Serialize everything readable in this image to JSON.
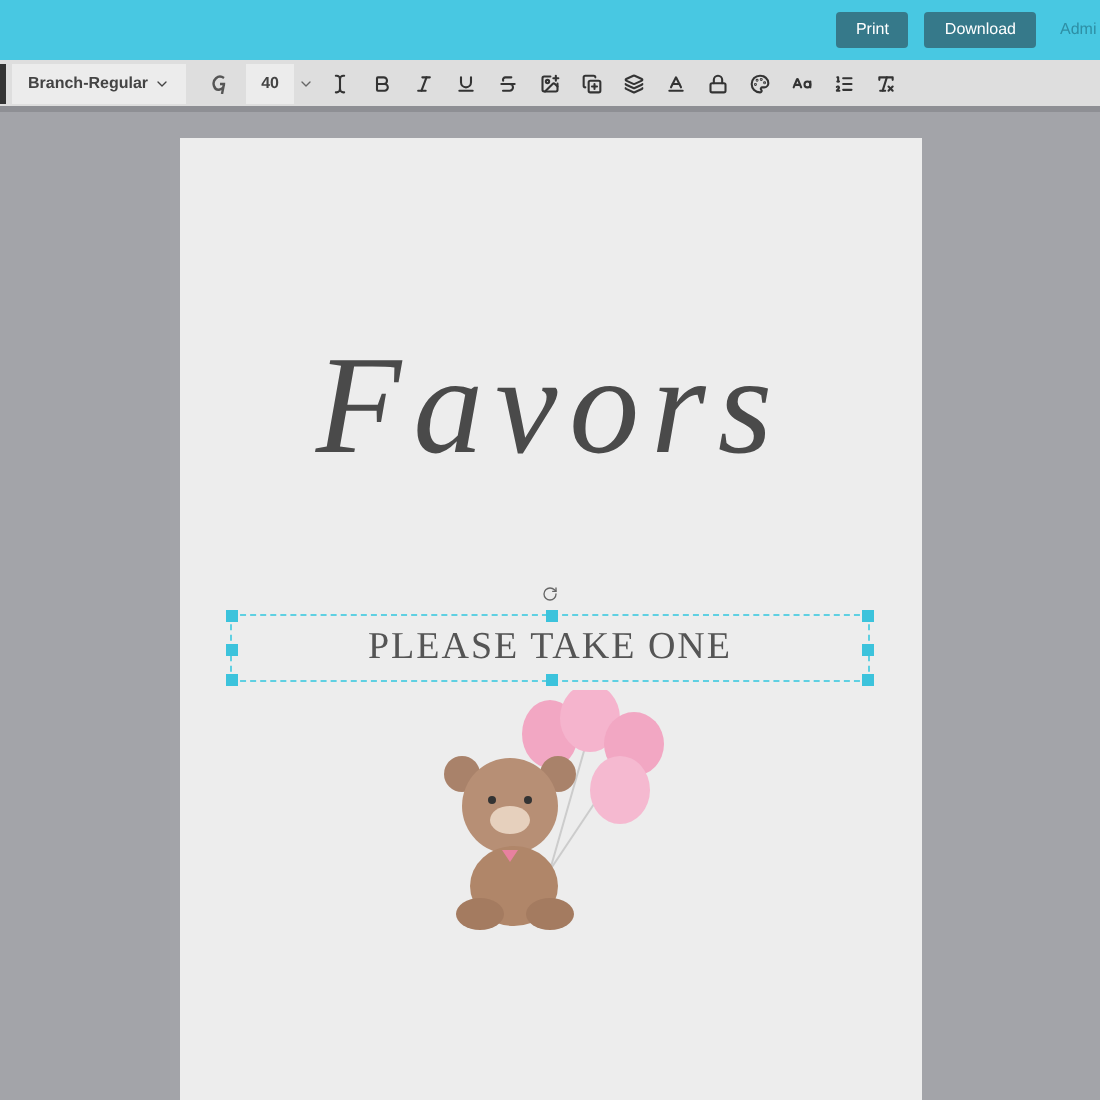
{
  "header": {
    "buttons": [
      "Print",
      "Download"
    ],
    "link": "Admi"
  },
  "toolbar": {
    "font": "Branch-Regular",
    "size": "40"
  },
  "page": {
    "title": "Favors",
    "subtitle": "PLEASE TAKE ONE",
    "subtitle_selected": true
  }
}
